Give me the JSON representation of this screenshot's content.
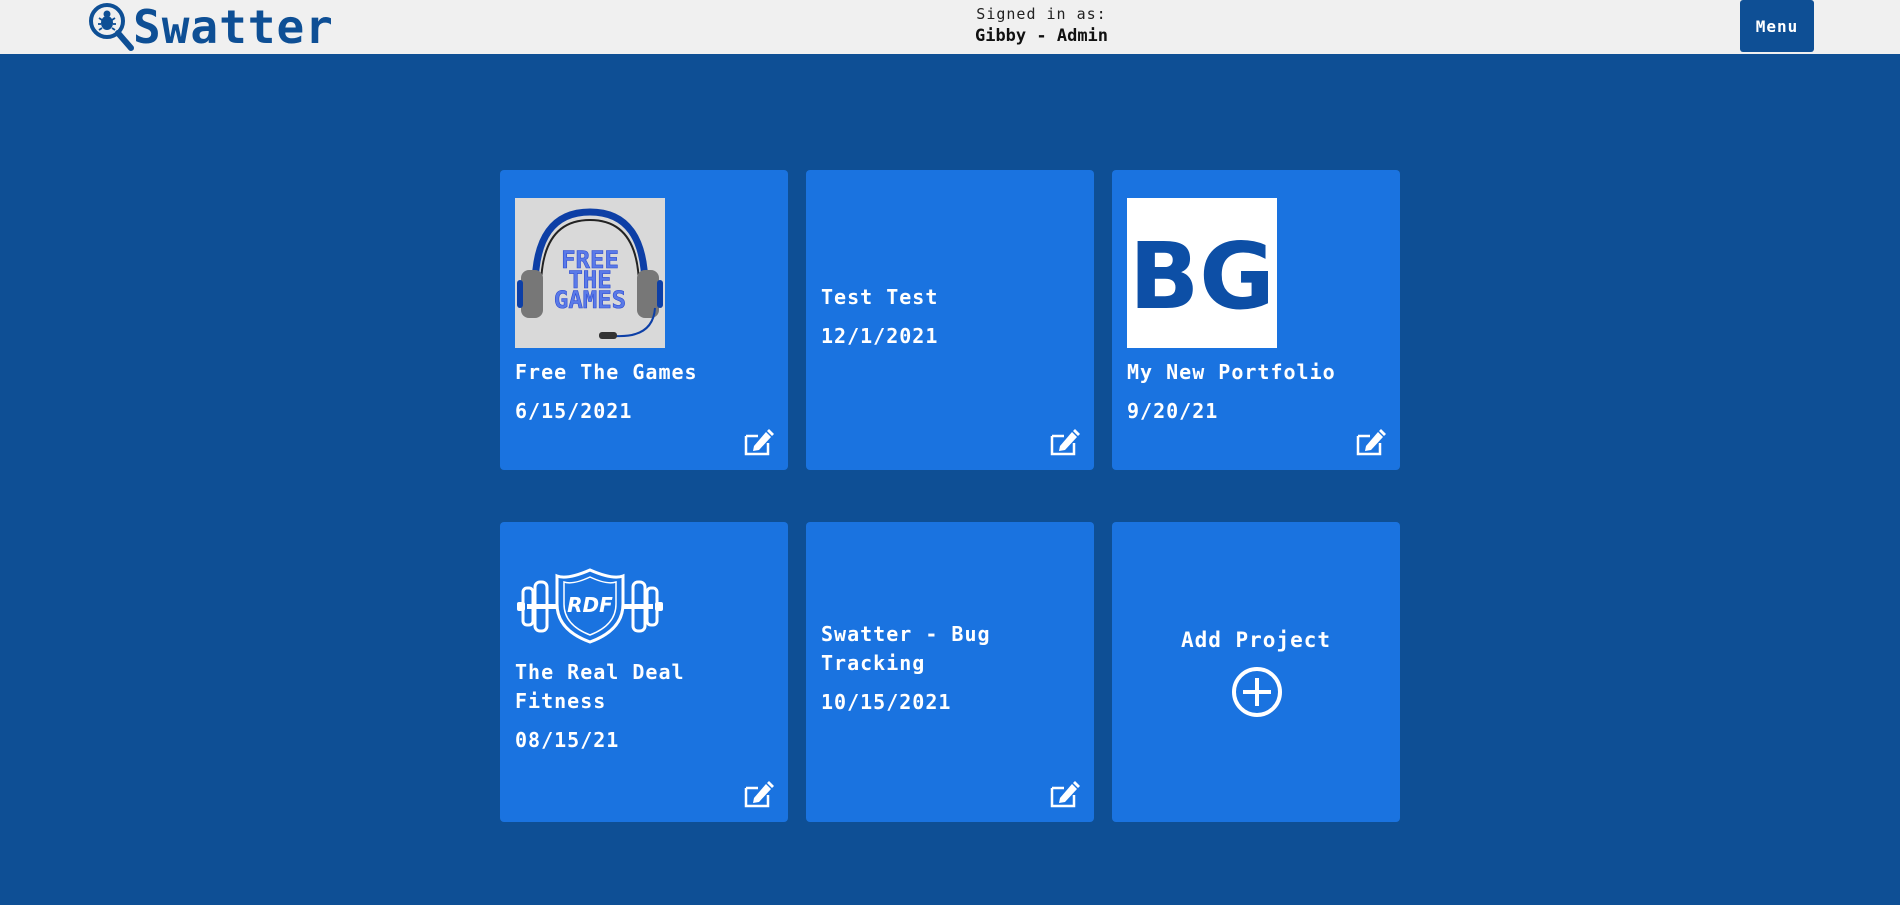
{
  "header": {
    "app_name": "Swatter",
    "signed_in_label": "Signed in as:",
    "signed_in_user": "Gibby - Admin",
    "menu_label": "Menu"
  },
  "projects": [
    {
      "title": "Free The Games",
      "date": "6/15/2021",
      "image": "free-the-games-logo",
      "image_text": [
        "FREE",
        "THE",
        "GAMES"
      ]
    },
    {
      "title": "Test Test",
      "date": "12/1/2021",
      "image": null
    },
    {
      "title": "My New Portfolio",
      "date": "9/20/21",
      "image": "bg-logo",
      "image_text": [
        "BG"
      ]
    },
    {
      "title": "The Real Deal Fitness",
      "date": "08/15/21",
      "image": "rdf-logo",
      "image_text": [
        "RDF"
      ]
    },
    {
      "title": "Swatter - Bug Tracking",
      "date": "10/15/2021",
      "image": null
    }
  ],
  "add_project": {
    "label": "Add Project"
  },
  "colors": {
    "background": "#0e4f95",
    "card": "#1a73e0",
    "header": "#f0f0f0"
  }
}
